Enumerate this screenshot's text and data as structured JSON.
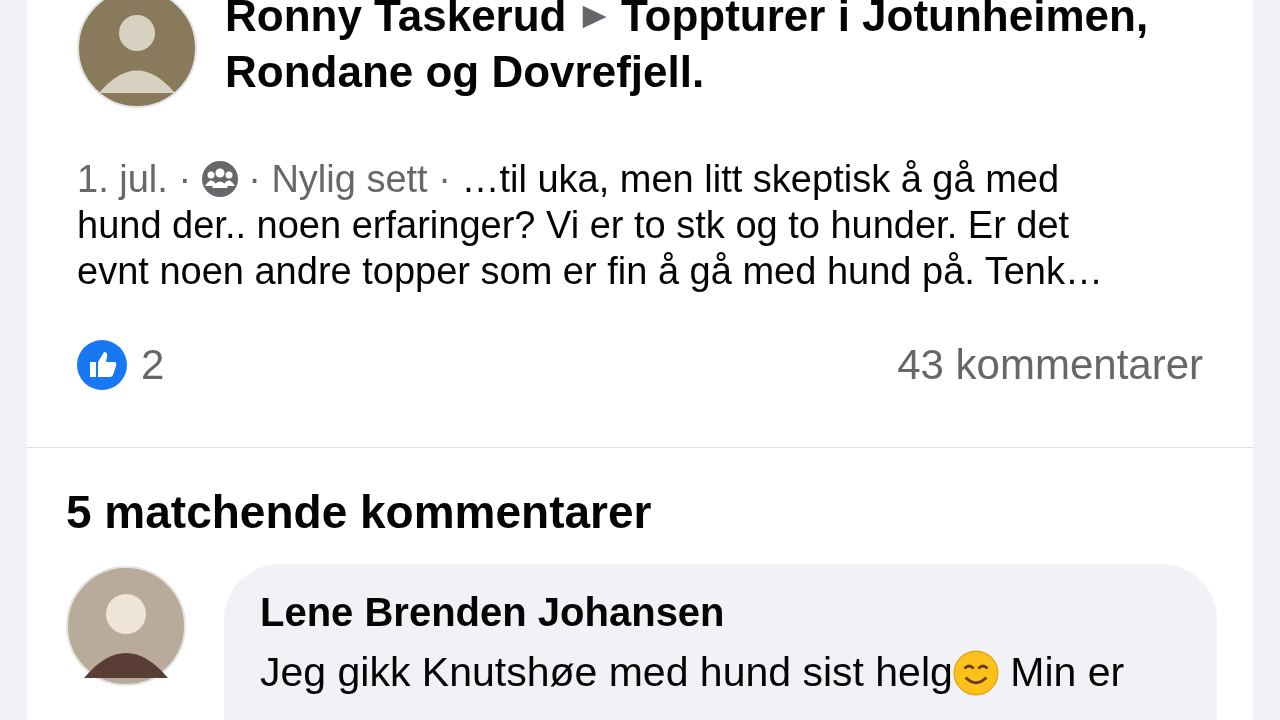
{
  "post": {
    "author": "Ronny Taskerud",
    "group_lines": [
      "Toppturer i Jotunheimen,",
      "Rondane og Dovrefjell."
    ],
    "meta_before": "1. jul. ·",
    "meta_after": "· Nylig sett ·",
    "text_lines": [
      "…til uka, men litt skeptisk å gå med",
      "hund der.. noen erfaringer? Vi er to stk og to hunder. Er det",
      "evnt noen andre topper som er fin å gå med hund på. Tenk…"
    ],
    "likes": "2",
    "comments": "43 kommentarer"
  },
  "matches": {
    "title": "5 matchende kommentarer",
    "comments": [
      {
        "author": "Lene Brenden Johansen",
        "text_before": "Jeg gikk Knutshøe med hund sist helg",
        "text_after": "Min er"
      }
    ]
  }
}
